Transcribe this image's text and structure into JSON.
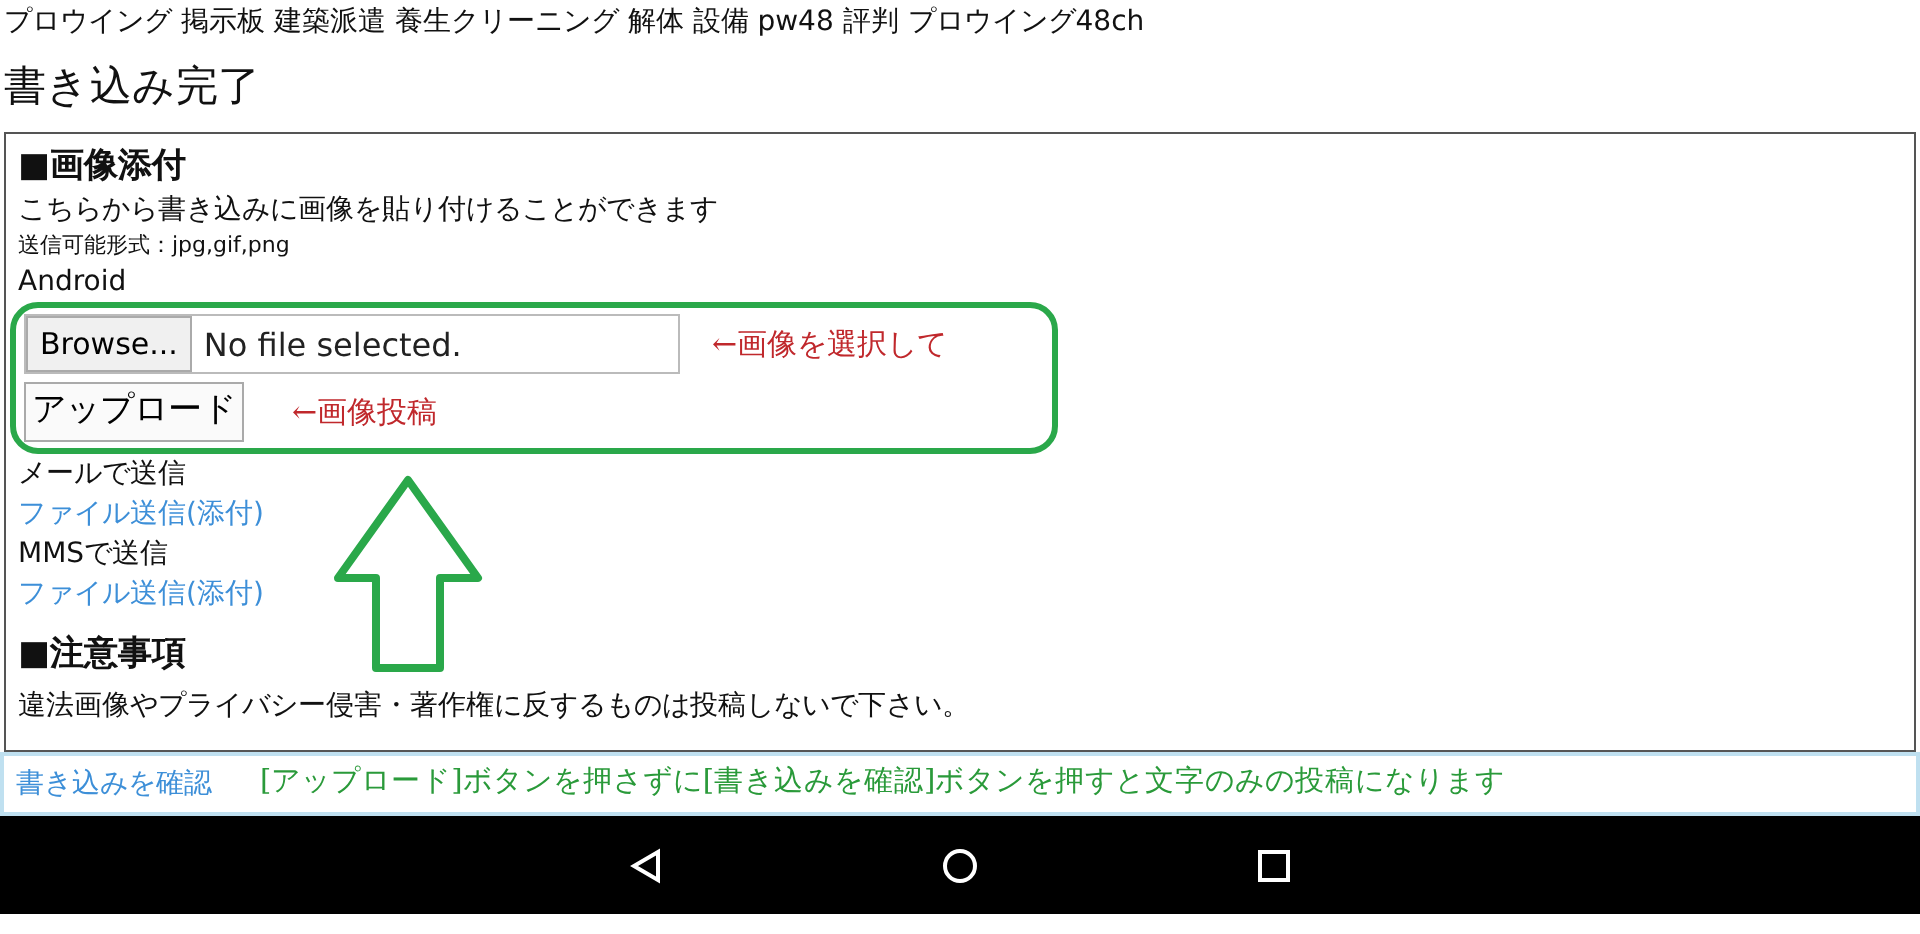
{
  "page_title": "プロウイング 掲示板 建築派遣 養生クリーニング 解体 設備 pw48 評判 プロウイング48ch",
  "heading": "書き込み完了",
  "image_section": {
    "title": "■画像添付",
    "description": "こちらから書き込みに画像を貼り付けることができます",
    "formats": "送信可能形式：jpg,gif,png",
    "platform": "Android",
    "file_field": {
      "button": "Browse...",
      "value": "No file selected.",
      "note": "←画像を選択して"
    },
    "upload_button": {
      "label": "アップロード",
      "note": "←画像投稿"
    },
    "send_options": [
      {
        "label": "メールで送信",
        "link": "ファイル送信(添付)"
      },
      {
        "label": "MMSで送信",
        "link": "ファイル送信(添付)"
      }
    ]
  },
  "notice_section": {
    "title": "■注意事項",
    "text": "違法画像やプライバシー侵害・著作権に反するものは投稿しないで下さい。"
  },
  "footer": {
    "link": "書き込みを確認",
    "note": "[アップロード]ボタンを押さずに[書き込みを確認]ボタンを押すと文字のみの投稿になります"
  }
}
